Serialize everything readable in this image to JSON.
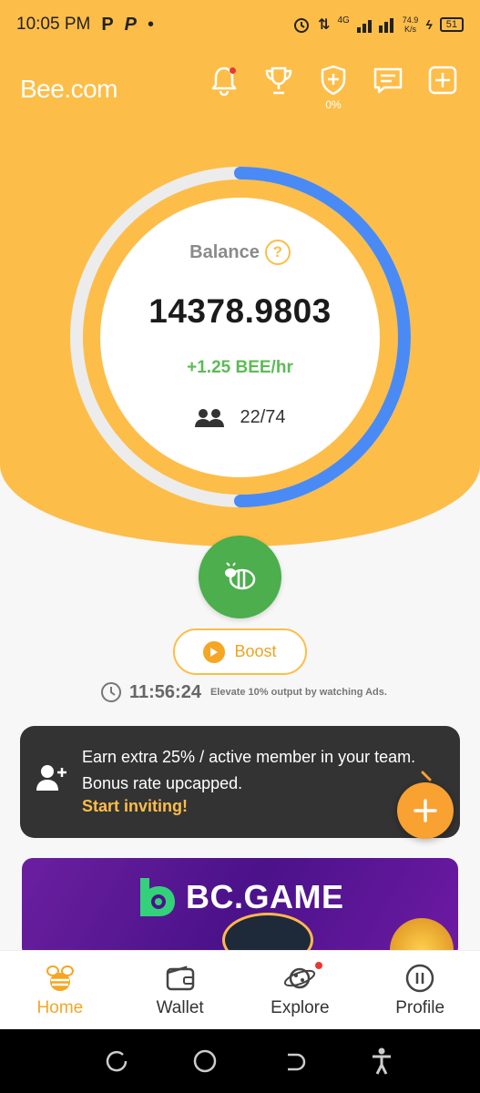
{
  "status": {
    "time": "10:05 PM",
    "left_icons": [
      "P",
      "P",
      "•"
    ],
    "network": "4G",
    "speed_value": "74.9",
    "speed_unit": "K/s",
    "battery": "51"
  },
  "header": {
    "logo": "Bee.com",
    "icons": [
      "bell-icon",
      "trophy-icon",
      "shield-plus-icon",
      "chat-icon",
      "plus-square-icon"
    ],
    "shield_percent": "0%"
  },
  "balance": {
    "label": "Balance",
    "help": "?",
    "value": "14378.9803",
    "rate": "+1.25 BEE/hr",
    "members": "22/74"
  },
  "ring": {
    "progress_fraction": 0.5,
    "track_color": "#ececec",
    "progress_color": "#4a8af4"
  },
  "boost": {
    "label": "Boost",
    "timer": "11:56:24",
    "note": "Elevate 10% output by watching Ads."
  },
  "invite": {
    "text": "Earn extra 25% / active member in your team. Bonus rate upcapped.",
    "link": "Start inviting!"
  },
  "banner": {
    "brand": "BC.GAME"
  },
  "nav": {
    "items": [
      {
        "label": "Home",
        "icon": "bee-icon",
        "active": true
      },
      {
        "label": "Wallet",
        "icon": "wallet-icon"
      },
      {
        "label": "Explore",
        "icon": "planet-icon"
      },
      {
        "label": "Profile",
        "icon": "pause-circle-icon"
      }
    ]
  },
  "colors": {
    "brand_yellow": "#fdbd49",
    "green": "#4cae4c",
    "rate_green": "#5cbb55",
    "accent_orange": "#f5a623",
    "card_dark": "#333333",
    "ring_blue": "#4a8af4"
  }
}
